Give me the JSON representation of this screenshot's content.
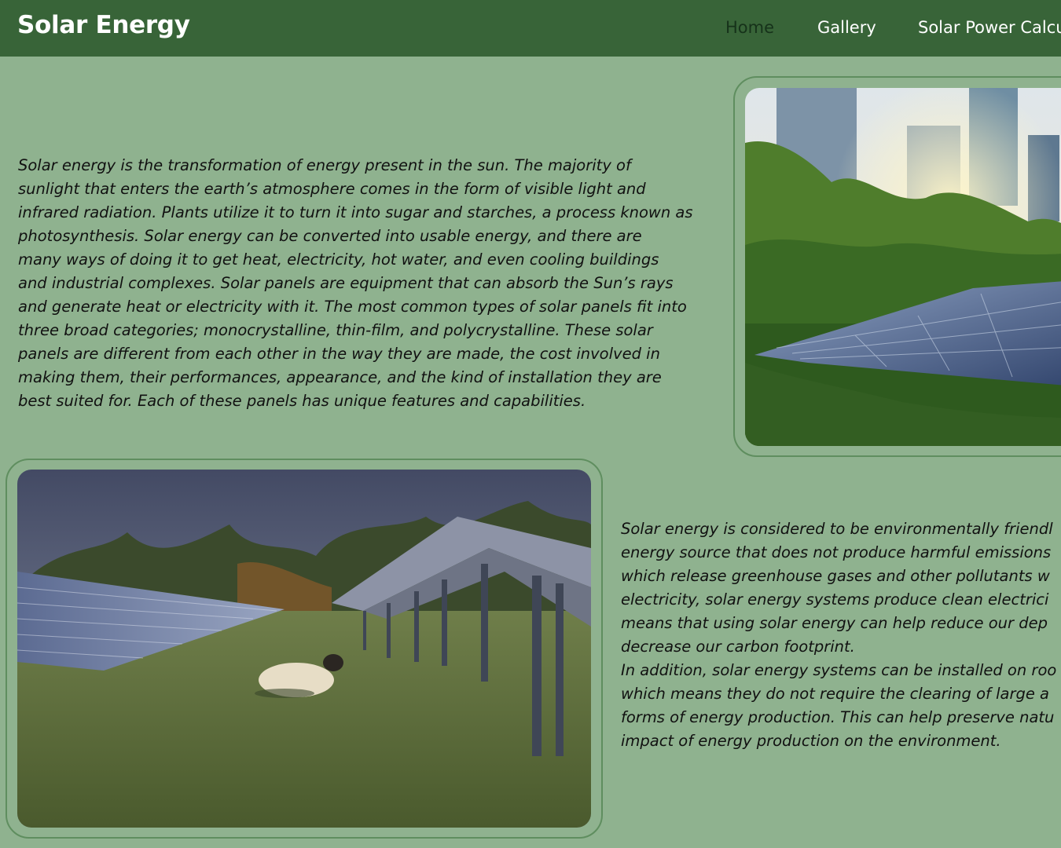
{
  "header": {
    "brand": "Solar Energy",
    "nav": [
      "Home",
      "Gallery",
      "Solar Power Calcu"
    ],
    "active_nav": "Home"
  },
  "main": {
    "paragraph_1": [
      "Solar energy is the transformation of energy present in the sun. The majority of",
      "sunlight that enters the earth’s atmosphere comes in the form of visible light and",
      "infrared radiation. Plants utilize it to turn it into sugar and starches, a process known as",
      "photosynthesis. Solar energy can be converted into usable energy, and there are",
      "many ways of doing it to get heat, electricity, hot water, and even cooling buildings",
      "and industrial complexes. Solar panels are equipment that can absorb the Sun’s rays",
      "and generate heat or electricity with it. The most common types of solar panels fit into",
      "three broad categories; monocrystalline, thin-film, and polycrystalline. These solar",
      "panels are different from each other in the way they are made, the cost involved in",
      "making them, their performances, appearance, and the kind of installation they are",
      "best suited for. Each of these panels has unique features and capabilities."
    ],
    "paragraph_2": [
      "Solar energy is considered to be environmentally friendl",
      "energy source that does not produce harmful emissions",
      "which release greenhouse gases and other pollutants w",
      "electricity, solar energy systems produce clean electrici",
      "means that using solar energy can help reduce our dep",
      "decrease our carbon footprint.",
      "In addition, solar energy systems can be installed on roo",
      "which means they do not require the clearing of large a",
      "forms of energy production. This can help preserve natu",
      "impact of energy production on the environment."
    ]
  },
  "colors": {
    "background": "#8fb28f",
    "navbar": "#386438",
    "frame_border": "#5f8e5f",
    "text": "#111111"
  },
  "images": [
    "city-solar-panels-photo",
    "sheep-solar-farm-photo"
  ]
}
